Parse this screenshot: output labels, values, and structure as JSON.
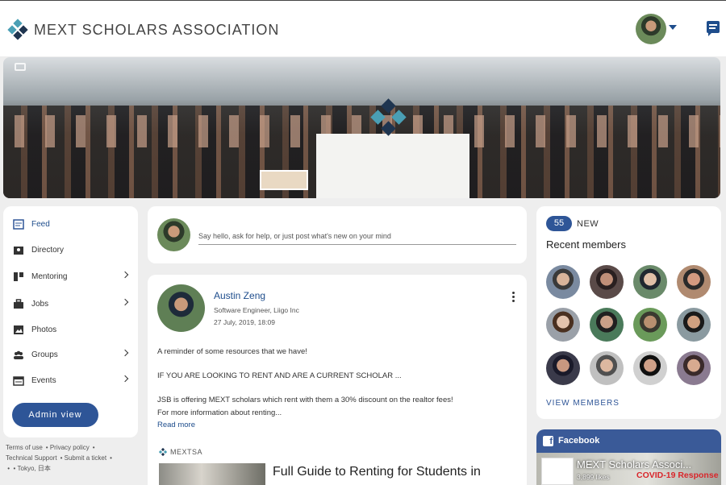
{
  "header": {
    "brand": "MEXT SCHOLARS ASSOCIATION",
    "logo_icon": "diamond-logo-icon",
    "messages_icon": "chat-icon"
  },
  "colors": {
    "accent": "#2e5597",
    "link": "#1e4d8c",
    "logo_teal": "#4a9fb5",
    "logo_dark": "#1f3550",
    "facebook": "#3a5a98",
    "covid_red": "#d9262b"
  },
  "sidebar": {
    "items": [
      {
        "label": "Feed",
        "icon": "feed-icon",
        "has_chevron": false
      },
      {
        "label": "Directory",
        "icon": "directory-icon",
        "has_chevron": false
      },
      {
        "label": "Mentoring",
        "icon": "mentoring-icon",
        "has_chevron": true
      },
      {
        "label": "Jobs",
        "icon": "briefcase-icon",
        "has_chevron": true
      },
      {
        "label": "Photos",
        "icon": "photo-icon",
        "has_chevron": false
      },
      {
        "label": "Groups",
        "icon": "groups-icon",
        "has_chevron": true
      },
      {
        "label": "Events",
        "icon": "calendar-icon",
        "has_chevron": true
      }
    ],
    "admin_button": "Admin view"
  },
  "footer": {
    "terms": "Terms of use",
    "privacy": "Privacy policy",
    "support": "Technical Support",
    "ticket": "Submit a ticket",
    "location": "Tokyo, 日本"
  },
  "composer": {
    "placeholder": "Say hello, ask for help, or just post what's new on your mind"
  },
  "post": {
    "author": "Austin Zeng",
    "subtitle": "Software Engineer, Liigo Inc",
    "date": "27 July, 2019, 18:09",
    "line1": "A reminder of some resources that we have!",
    "line2": "IF YOU ARE LOOKING TO RENT AND ARE A CURRENT SCHOLAR ...",
    "line3": "JSB is offering MEXT scholars which rent with them a 30% discount on the realtor fees!",
    "line4": "For more information about renting...",
    "read_more": "Read more",
    "source": "MEXTSA",
    "article_title": "Full Guide to Renting for Students in"
  },
  "members": {
    "new_count": "55",
    "new_label": "NEW",
    "title": "Recent members",
    "view_all": "VIEW MEMBERS"
  },
  "facebook": {
    "label": "Facebook",
    "page_name": "MEXT Scholars Associ...",
    "likes": "3,899 likes",
    "banner": "COVID-19 Response"
  }
}
